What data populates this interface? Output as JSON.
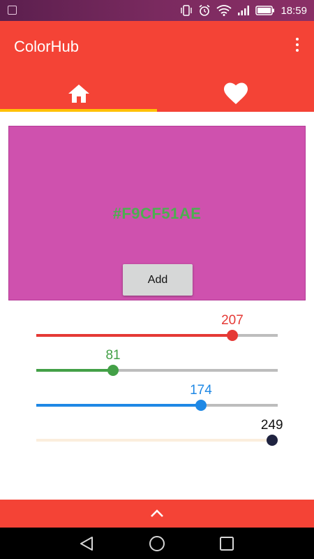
{
  "status_bar": {
    "time": "18:59",
    "icons": [
      "gallery-icon",
      "vibrate-icon",
      "alarm-icon",
      "wifi-icon",
      "signal-icon",
      "battery-icon"
    ]
  },
  "app": {
    "title": "ColorHub",
    "bar_color": "#f44336",
    "indicator_color": "#ffc107"
  },
  "tabs": [
    {
      "icon": "home-icon",
      "selected": true
    },
    {
      "icon": "heart-icon",
      "selected": false
    }
  ],
  "preview": {
    "color": "#cf51ae",
    "hex": "#F9CF51AE",
    "hex_color": "#4caf50",
    "add_label": "Add"
  },
  "sliders": [
    {
      "name": "red",
      "value": "207",
      "fraction": 0.812,
      "color": "#e53935"
    },
    {
      "name": "green",
      "value": "81",
      "fraction": 0.318,
      "color": "#43a047"
    },
    {
      "name": "blue",
      "value": "174",
      "fraction": 0.682,
      "color": "#1e88e5"
    },
    {
      "name": "alpha",
      "value": "249",
      "fraction": 0.976,
      "color": "#fbeedd",
      "thumb_color": "#1f2340",
      "value_color": "#111111"
    }
  ],
  "bottom_bar": {
    "icon": "chevron-up-icon"
  },
  "nav_bar": {
    "icons": [
      "back-icon",
      "home-circle-icon",
      "recents-icon"
    ]
  }
}
